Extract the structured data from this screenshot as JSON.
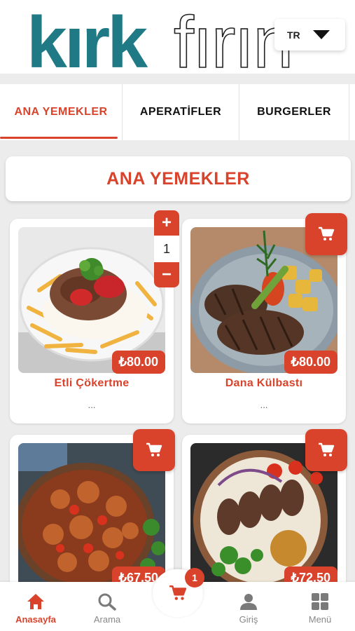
{
  "brand": {
    "logo_part1": "kırk",
    "logo_part2": "fırın",
    "logo_color": "#1f7a85",
    "accent": "#d9432c"
  },
  "language": {
    "selected": "TR"
  },
  "tabs": [
    {
      "label": "ANA YEMEKLER",
      "active": true
    },
    {
      "label": "APERATİFLER",
      "active": false
    },
    {
      "label": "BURGERLER",
      "active": false
    }
  ],
  "section": {
    "title": "ANA YEMEKLER"
  },
  "products": [
    {
      "name": "Etli Çökertme",
      "price": "₺80.00",
      "more": "...",
      "quantity": "1",
      "image_icon": "kebab-yogurt-fries-image"
    },
    {
      "name": "Dana Külbastı",
      "price": "₺80.00",
      "more": "...",
      "image_icon": "grilled-steak-potatoes-image"
    },
    {
      "name": "",
      "price": "₺67.50",
      "more": "",
      "image_icon": "chicken-stew-pan-image"
    },
    {
      "name": "",
      "price": "₺72.50",
      "more": "",
      "image_icon": "kofte-bulgur-plate-image"
    }
  ],
  "stepper": {
    "plus": "+",
    "minus": "−"
  },
  "bottom_nav": {
    "home": "Anasayfa",
    "search": "Arama",
    "login": "Giriş",
    "menu": "Menü",
    "cart_count": "1"
  }
}
